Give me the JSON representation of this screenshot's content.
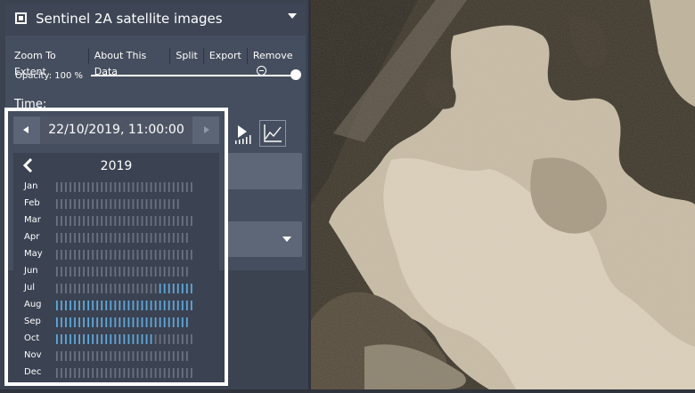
{
  "layer": {
    "title": "Sentinel 2A satellite images"
  },
  "menu": {
    "zoom": "Zoom To Extent",
    "about": "About This Data",
    "split": "Split",
    "export": "Export",
    "remove": "Remove"
  },
  "opacity": {
    "label": "Opacity: 100 %",
    "value": 1.0
  },
  "time": {
    "label": "Time:",
    "current_date": "22/10/2019, 11:00:00"
  },
  "calendar": {
    "year": "2019",
    "months": [
      {
        "name": "Jan",
        "total": 31,
        "available_from": 0,
        "available_to": 0
      },
      {
        "name": "Feb",
        "total": 28,
        "available_from": 0,
        "available_to": 0
      },
      {
        "name": "Mar",
        "total": 31,
        "available_from": 0,
        "available_to": 0
      },
      {
        "name": "Apr",
        "total": 30,
        "available_from": 0,
        "available_to": 0
      },
      {
        "name": "May",
        "total": 31,
        "available_from": 0,
        "available_to": 0
      },
      {
        "name": "Jun",
        "total": 30,
        "available_from": 0,
        "available_to": 0
      },
      {
        "name": "Jul",
        "total": 31,
        "available_from": 24,
        "available_to": 31
      },
      {
        "name": "Aug",
        "total": 31,
        "available_from": 1,
        "available_to": 31
      },
      {
        "name": "Sep",
        "total": 30,
        "available_from": 1,
        "available_to": 30
      },
      {
        "name": "Oct",
        "total": 31,
        "available_from": 1,
        "available_to": 22
      },
      {
        "name": "Nov",
        "total": 30,
        "available_from": 0,
        "available_to": 0
      },
      {
        "name": "Dec",
        "total": 31,
        "available_from": 0,
        "available_to": 0
      }
    ]
  },
  "colors": {
    "panel_bg": "#3b4250",
    "item_bg": "#454e5e",
    "available_tick": "#5fa8d8",
    "unavailable_tick": "#6b7382"
  }
}
